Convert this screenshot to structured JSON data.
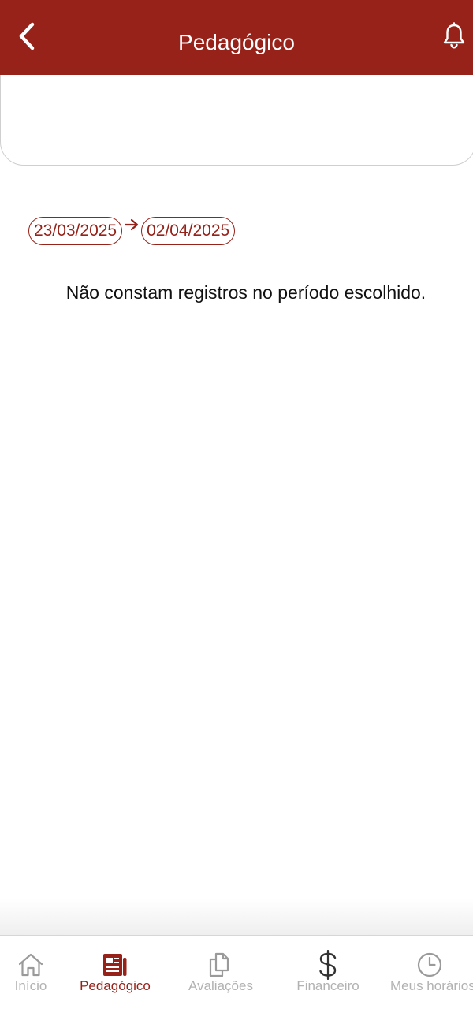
{
  "header": {
    "title": "Pedagógico",
    "back_icon": "chevron-left-icon",
    "notification_icon": "bell-icon",
    "background": "#962219"
  },
  "filter": {
    "start_date": "23/03/2025",
    "end_date": "02/04/2025",
    "separator_icon": "arrow-right-icon",
    "accent": "#962219"
  },
  "main": {
    "empty_message": "Não constam registros no período escolhido."
  },
  "bottom_nav": {
    "items": [
      {
        "label": "Início",
        "icon": "home-icon",
        "active": false
      },
      {
        "label": "Pedagógico",
        "icon": "newspaper-icon",
        "active": true
      },
      {
        "label": "Avaliações",
        "icon": "documents-icon",
        "active": false
      },
      {
        "label": "Financeiro",
        "icon": "dollar-icon",
        "active": false
      },
      {
        "label": "Meus horários",
        "icon": "clock-icon",
        "active": false
      }
    ],
    "active_color": "#962219",
    "inactive_color": "#b2b2b2"
  }
}
